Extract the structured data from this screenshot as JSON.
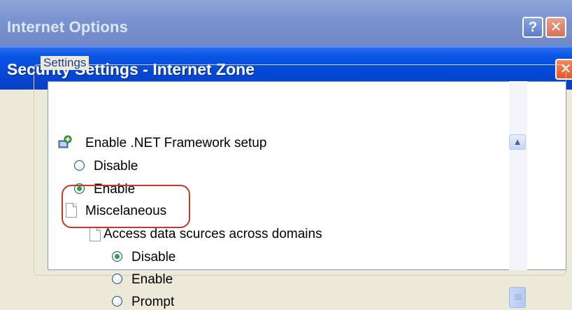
{
  "outer_window": {
    "title": "Internet Options",
    "help_label": "?",
    "close_label": "✕"
  },
  "dialog": {
    "title": "Security Settings - Internet Zone",
    "close_label": "✕"
  },
  "settings": {
    "group_label": "Settings",
    "items": [
      {
        "label": "Enable .NET Framework setup",
        "icon": "net-framework-icon"
      },
      {
        "label": "Disable",
        "checked": false
      },
      {
        "label": "Enable",
        "checked": true
      },
      {
        "label": "Miscelaneous",
        "icon": "page-icon"
      },
      {
        "label": "Access data scurces across domains",
        "icon": "page-icon"
      },
      {
        "label": "Disable",
        "checked": true
      },
      {
        "label": "Enable",
        "checked": false
      },
      {
        "label": "Prompt",
        "checked": false
      }
    ]
  },
  "scrollbar": {
    "up_label": "▲"
  },
  "colors": {
    "annotation": "#c0392b",
    "inner_titlebar": "#0447d6",
    "outer_titlebar": "#7b94cf"
  }
}
